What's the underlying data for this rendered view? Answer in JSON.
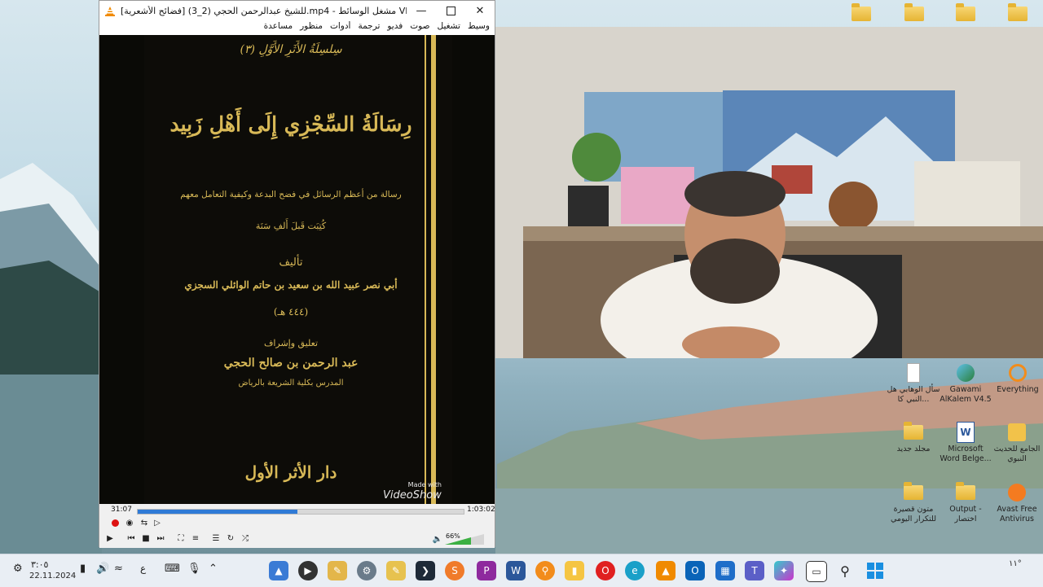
{
  "vlc": {
    "title": "[فضائح الأشعرية] للشيخ عبدالرحمن الحجي (2_3).mp4 - مشغل الوسائط VLC",
    "menu": [
      "وسيط",
      "تشغيل",
      "صوت",
      "فديو",
      "ترجمة",
      "أدوات",
      "منظور",
      "مساعدة"
    ],
    "time_elapsed": "31:07",
    "time_total": "1:03:02",
    "progress": 0.49,
    "volume": "66%",
    "watermark_top": "Made with",
    "watermark": "VideoShow"
  },
  "book": {
    "series": "سِلسِلَةُ الأَثَرِ الأَوَّلِ (٣)",
    "title": "رِسَالَةُ السِّجْزِي إِلَى أَهْلِ زَبِيد",
    "subtitle": "رسالة من أعظم الرسائل في فضح البدعة وكيفية التعامل معهم",
    "written": "كُتِبَت قَبلَ أَلفِ سَنَة",
    "author_label": "تأليف",
    "author": "أبي نصر عبيد الله بن سعيد بن حاتم الوائلي السجزي",
    "date": "(٤٤٤ هـ)",
    "editor_label": "تعليق وإشراف",
    "editor": "عبد الرحمن بن صالح الحجي",
    "editor_role": "المدرس بكلية الشريعة بالرياض",
    "publisher": "دار الأثر الأول"
  },
  "desktop_icons": [
    {
      "label": "سأل الوهابي هل النبي كا...",
      "icon": "document-icon"
    },
    {
      "label": "Gawami AlKalem V4.5",
      "icon": "gawami-app-icon"
    },
    {
      "label": "Everything",
      "icon": "everything-search-icon"
    },
    {
      "label": "مجلد جديد",
      "icon": "folder-icon"
    },
    {
      "label": "Microsoft Word Belge...",
      "icon": "word-document-icon"
    },
    {
      "label": "الجامع للحديث النبوي",
      "icon": "hadith-app-icon"
    },
    {
      "label": "متون قصيرة للتكرار اليومي",
      "icon": "folder-icon"
    },
    {
      "label": "Output - اختصار",
      "icon": "folder-shortcut-icon"
    },
    {
      "label": "Avast Free Antivirus",
      "icon": "avast-icon"
    }
  ],
  "taskbar": {
    "time": "٣:٠٥",
    "date": "22.11.2024",
    "lang": "ع",
    "temp": "١١°"
  },
  "colors": {
    "vlc_orange": "#f08a00",
    "seek_fill": "#2f7ad6",
    "book_gold": "#d8b957"
  }
}
